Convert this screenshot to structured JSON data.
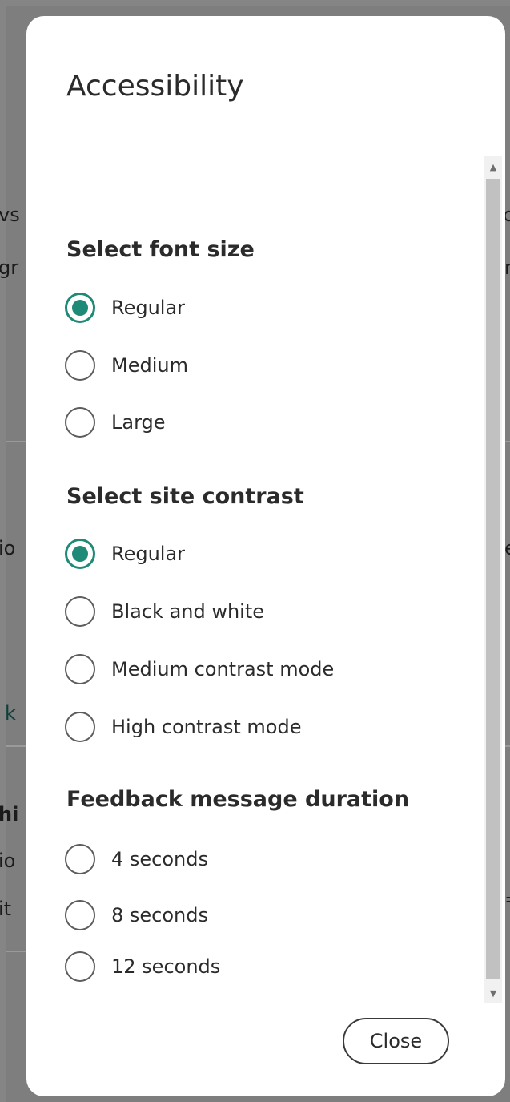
{
  "background": {
    "fragments": [
      {
        "text": "vs",
        "side": "left"
      },
      {
        "text": "gr",
        "side": "left"
      },
      {
        "text": "io",
        "side": "left"
      },
      {
        "text": "k",
        "side": "left",
        "accent": true
      },
      {
        "text": "hi",
        "side": "left",
        "bold": true
      },
      {
        "text": "io",
        "side": "left"
      },
      {
        "text": "it",
        "side": "left"
      },
      {
        "text": "c",
        "side": "right"
      },
      {
        "text": "n",
        "side": "right"
      },
      {
        "text": "e",
        "side": "right"
      },
      {
        "text": "=",
        "side": "right"
      }
    ]
  },
  "modal": {
    "title": "Accessibility",
    "close_label": "Close"
  },
  "font_size": {
    "title": "Select font size",
    "options": [
      {
        "label": "Regular",
        "checked": true
      },
      {
        "label": "Medium",
        "checked": false
      },
      {
        "label": "Large",
        "checked": false
      }
    ]
  },
  "contrast": {
    "title": "Select site contrast",
    "options": [
      {
        "label": "Regular",
        "checked": true
      },
      {
        "label": "Black and white",
        "checked": false
      },
      {
        "label": "Medium contrast mode",
        "checked": false
      },
      {
        "label": "High contrast mode",
        "checked": false
      }
    ]
  },
  "feedback": {
    "title": "Feedback message duration",
    "options": [
      {
        "label": "4 seconds",
        "checked": false
      },
      {
        "label": "8 seconds",
        "checked": false
      },
      {
        "label": "12 seconds",
        "checked": false
      }
    ]
  },
  "colors": {
    "accent": "#1f8a78",
    "text": "#2b2b2b",
    "backdrop": "#858585",
    "surface": "#ffffff"
  },
  "icons": {
    "scroll_up": "scroll-up-arrow-icon",
    "scroll_down": "scroll-down-arrow-icon"
  }
}
